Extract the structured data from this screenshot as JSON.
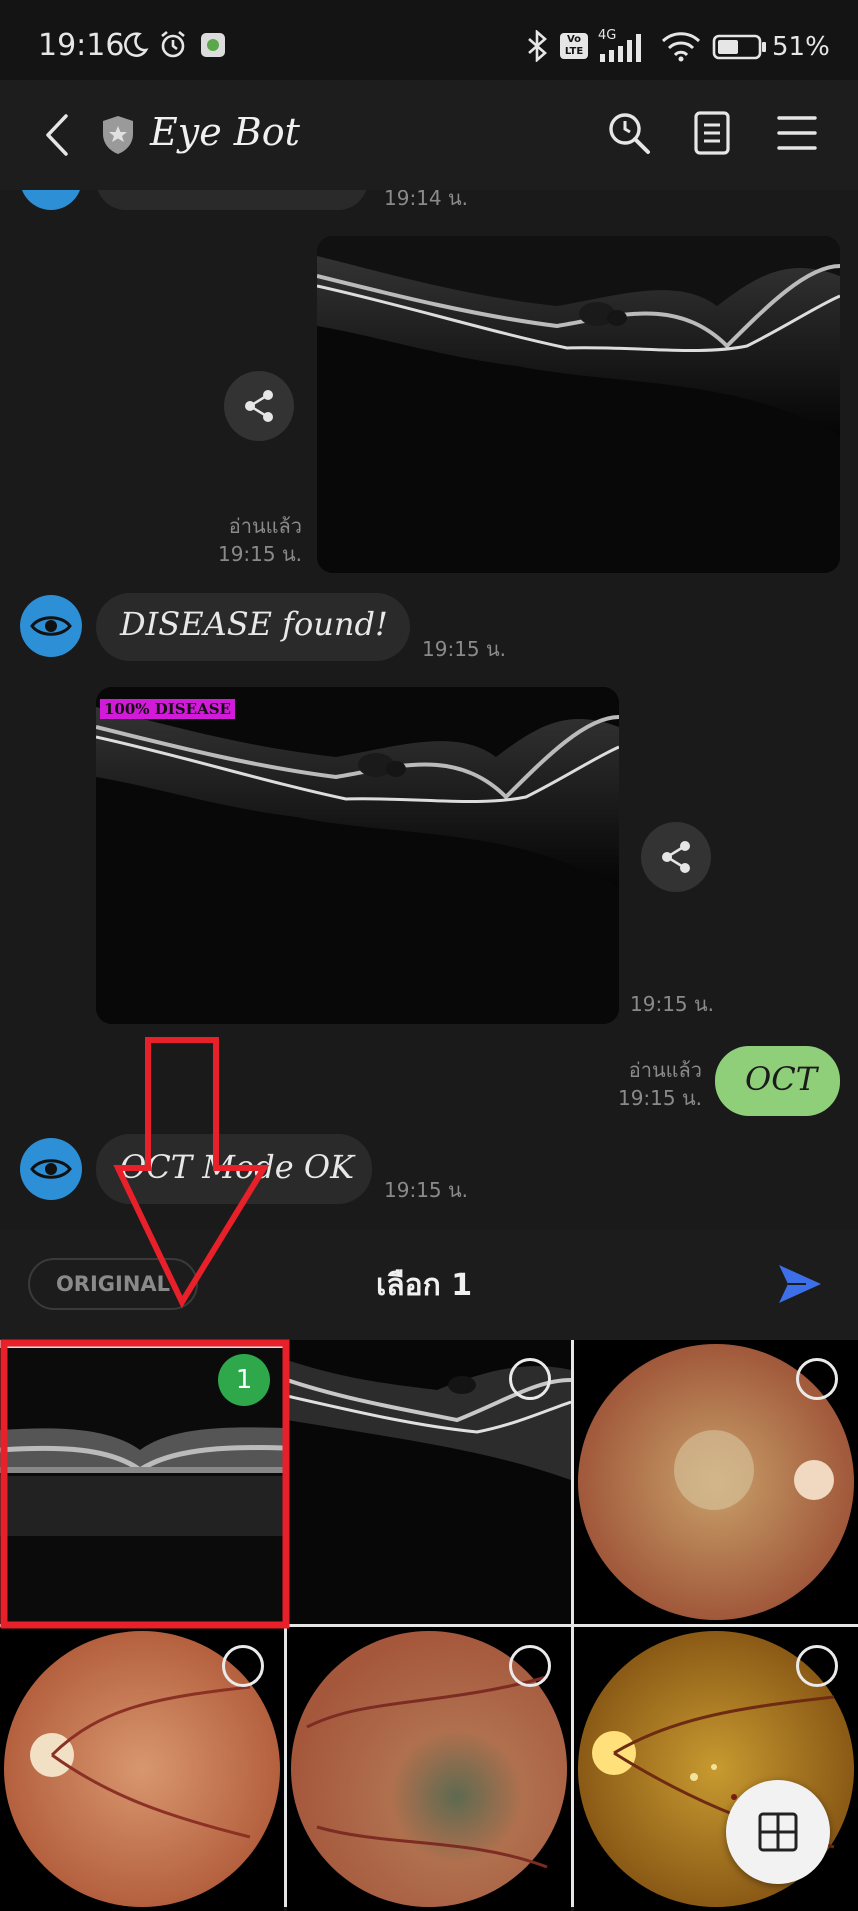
{
  "status_bar": {
    "time": "19:16",
    "network": "4G",
    "volte": "Vo LTE",
    "battery_percent": "51%",
    "icons": [
      "moon-icon",
      "alarm-icon",
      "app-icon",
      "bluetooth-icon",
      "volte-icon",
      "signal-icon",
      "wifi-icon",
      "battery-icon"
    ]
  },
  "header": {
    "title": "Eye Bot",
    "icons": [
      "back-icon",
      "shield-icon",
      "search-icon",
      "notes-icon",
      "menu-icon"
    ]
  },
  "messages": {
    "top_time": "19:14 น.",
    "sent_image": {
      "read": "อ่านแล้ว",
      "time": "19:15 น."
    },
    "bot_text_1": {
      "text": "DISEASE found!",
      "time": "19:15 น."
    },
    "bot_image": {
      "label": "100% DISEASE",
      "time": "19:15 น."
    },
    "sent_text": {
      "text": "OCT",
      "read": "อ่านแล้ว",
      "time": "19:15 น."
    },
    "bot_text_2": {
      "text": "OCT Mode OK",
      "time": "19:15 น."
    }
  },
  "picker": {
    "original_label": "ORIGINAL",
    "select_label": "เลือก 1",
    "selected_number": "1"
  },
  "colors": {
    "accent_blue": "#2d8fd5",
    "sent_bubble": "#8fcf7a",
    "send_arrow": "#3d6fe8",
    "selected_badge": "#2ea84a",
    "annotation_red": "#e8202a",
    "label_magenta": "#d21ad9"
  }
}
